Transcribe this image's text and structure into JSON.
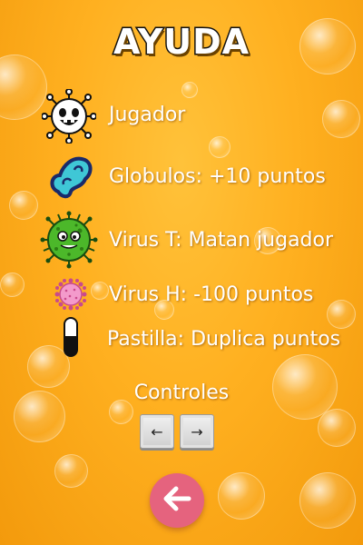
{
  "title": "AYUDA",
  "items": [
    {
      "icon": "white-spiky-player-icon",
      "label": "Jugador"
    },
    {
      "icon": "blue-globule-icon",
      "label": "Globulos: +10 puntos"
    },
    {
      "icon": "green-virus-icon",
      "label": "Virus T: Matan jugador"
    },
    {
      "icon": "pink-virus-icon",
      "label": "Virus H: -100 puntos"
    },
    {
      "icon": "pill-icon",
      "label": "Pastilla: Duplica puntos"
    }
  ],
  "controls": {
    "label": "Controles",
    "left_key": "←",
    "right_key": "→"
  },
  "back_icon": "back-arrow-icon",
  "colors": {
    "background": "#ffb020",
    "back_button": "#e5637e",
    "globule": "#3fc7d6",
    "green_virus": "#4cb82a",
    "pink_virus": "#f39acb"
  }
}
